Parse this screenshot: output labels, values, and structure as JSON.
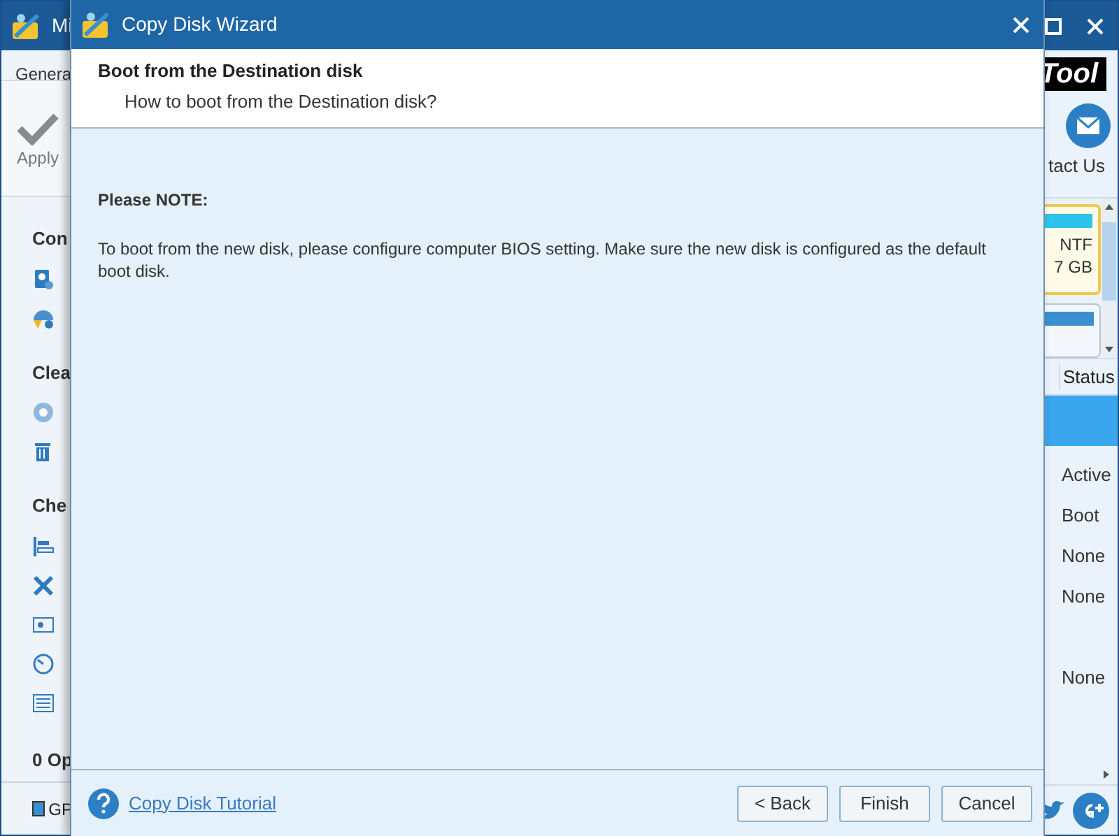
{
  "app": {
    "title": "Mi",
    "menu_tab": "Genera",
    "apply": "Apply",
    "logo": "Tool",
    "contact": "tact Us",
    "sections": [
      {
        "label": "Con",
        "items": [
          {
            "kind": "disk"
          },
          {
            "kind": "convert"
          }
        ]
      },
      {
        "label": "Clea",
        "items": [
          {
            "kind": "globe"
          },
          {
            "kind": "trash"
          }
        ]
      },
      {
        "label": "Che",
        "items": [
          {
            "kind": "bars"
          },
          {
            "kind": "tools"
          },
          {
            "kind": "card"
          },
          {
            "kind": "gauge"
          },
          {
            "kind": "list"
          }
        ]
      }
    ],
    "operations": "0 Op",
    "legend": {
      "label": "GP",
      "color": "#3a8fd0"
    },
    "disk_cards": [
      {
        "fs": "NTF",
        "size": "7 GB",
        "selected": true
      },
      {
        "selected": false
      }
    ],
    "table": {
      "columns": [
        "Status"
      ],
      "rows": [
        {
          "status": "",
          "selected": true
        },
        {
          "status": "Active",
          "selected": false
        },
        {
          "status": "Boot",
          "selected": false
        },
        {
          "status": "None",
          "selected": false
        },
        {
          "status": "None",
          "selected": false
        },
        {
          "status": "",
          "selected": false
        },
        {
          "status": "None",
          "selected": false
        }
      ]
    }
  },
  "dialog": {
    "title": "Copy Disk Wizard",
    "heading": "Boot from the Destination disk",
    "subheading": "How to boot from the Destination disk?",
    "note_title": "Please NOTE:",
    "note_text": "To boot from the new disk, please configure computer BIOS setting. Make sure the new disk is configured as the default boot disk.",
    "help_link": "Copy Disk Tutorial",
    "buttons": [
      "< Back",
      "Finish",
      "Cancel"
    ]
  }
}
